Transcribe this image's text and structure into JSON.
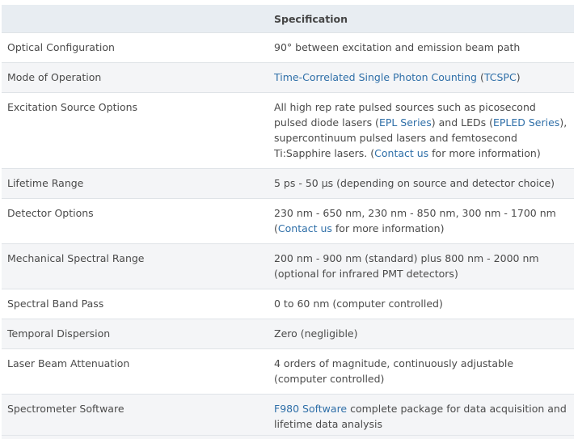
{
  "table": {
    "headers": [
      "",
      "Specification"
    ],
    "rows": [
      {
        "label": "Optical Configuration",
        "value": [
          "90° between excitation and emission beam path"
        ]
      },
      {
        "label": "Mode of Operation",
        "value": [
          {
            "link": "Time-Correlated Single Photon Counting"
          },
          " (",
          {
            "link": "TCSPC"
          },
          ")"
        ]
      },
      {
        "label": "Excitation Source Options",
        "value": [
          "All high rep rate pulsed sources such as picosecond pulsed diode lasers (",
          {
            "link": "EPL Series"
          },
          ") and LEDs (",
          {
            "link": "EPLED Series"
          },
          "), supercontinuum pulsed lasers and femtosecond Ti:Sapphire lasers. (",
          {
            "link": "Contact us"
          },
          " for more information)"
        ]
      },
      {
        "label": "Lifetime Range",
        "value": [
          "5 ps - 50 µs (depending on source and detector choice)"
        ]
      },
      {
        "label": "Detector Options",
        "value": [
          "230 nm - 650 nm, 230 nm - 850 nm, 300 nm - 1700 nm (",
          {
            "link": "Contact us"
          },
          " for more information)"
        ]
      },
      {
        "label": "Mechanical Spectral Range",
        "value": [
          "200 nm - 900 nm (standard) plus 800 nm - 2000 nm (optional for infrared PMT detectors)"
        ]
      },
      {
        "label": "Spectral Band Pass",
        "value": [
          "0 to 60 nm (computer controlled)"
        ]
      },
      {
        "label": "Temporal Dispersion",
        "value": [
          "Zero (negligible)"
        ]
      },
      {
        "label": "Laser Beam Attenuation",
        "value": [
          "4 orders of magnitude, continuously adjustable (computer controlled)"
        ]
      },
      {
        "label": "Spectrometer Software",
        "value": [
          {
            "link": "F980 Software"
          },
          " complete package for data acquisition and lifetime data analysis"
        ]
      }
    ]
  },
  "colors": {
    "header_bg": "#e8edf2",
    "alt_row_bg": "#f4f5f7",
    "link": "#2f6fa8",
    "text": "#4a4a4a"
  }
}
